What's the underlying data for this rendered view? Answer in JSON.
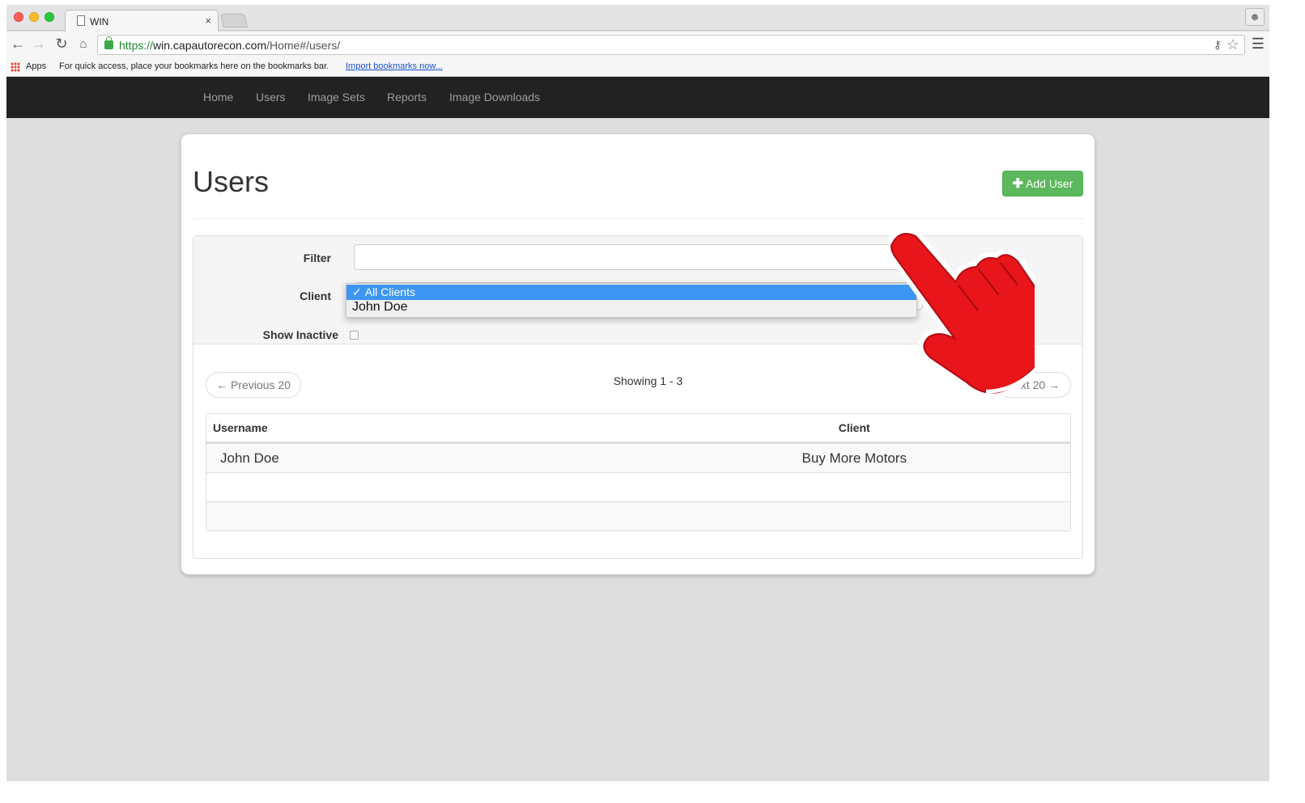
{
  "browser": {
    "tab_title": "WIN",
    "tab_close": "×",
    "url_scheme": "https://",
    "url_host": "win.capautorecon.com",
    "url_path": "/Home#/users/",
    "bookmarks": {
      "apps_label": "Apps",
      "hint_text": "For quick access, place your bookmarks here on the bookmarks bar.",
      "import_link": "Import bookmarks now..."
    }
  },
  "navbar": {
    "items": [
      {
        "label": "Home"
      },
      {
        "label": "Users"
      },
      {
        "label": "Image Sets"
      },
      {
        "label": "Reports"
      },
      {
        "label": "Image Downloads"
      }
    ]
  },
  "page": {
    "title": "Users",
    "add_user_label": "Add User"
  },
  "filters": {
    "filter_label": "Filter",
    "filter_value": "",
    "client_label": "Client",
    "client_options": [
      {
        "label": "All Clients",
        "selected": true
      },
      {
        "label": "John Doe",
        "selected": false
      }
    ],
    "show_inactive_label": "Show Inactive",
    "show_inactive_checked": false
  },
  "pagination": {
    "prev_label": "← Previous 20",
    "next_label": "Next 20 →",
    "showing_text": "Showing 1 - 3"
  },
  "table": {
    "columns": [
      "Username",
      "Client"
    ],
    "rows": [
      {
        "username": "John Doe",
        "client": "Buy More Motors"
      },
      {
        "username": "",
        "client": ""
      },
      {
        "username": "",
        "client": ""
      }
    ]
  },
  "colors": {
    "navbar_bg": "#222222",
    "add_button": "#5cb85c",
    "selection": "#3d96f3",
    "hand_pointer": "#e8151b"
  },
  "icons": [
    "doc-icon",
    "close-icon",
    "back-arrow-icon",
    "forward-arrow-icon",
    "reload-icon",
    "home-icon",
    "lock-icon",
    "key-icon",
    "star-icon",
    "menu-icon",
    "apps-icon",
    "profile-icon",
    "plus-icon",
    "checkmark-icon",
    "hand-pointer-icon"
  ]
}
